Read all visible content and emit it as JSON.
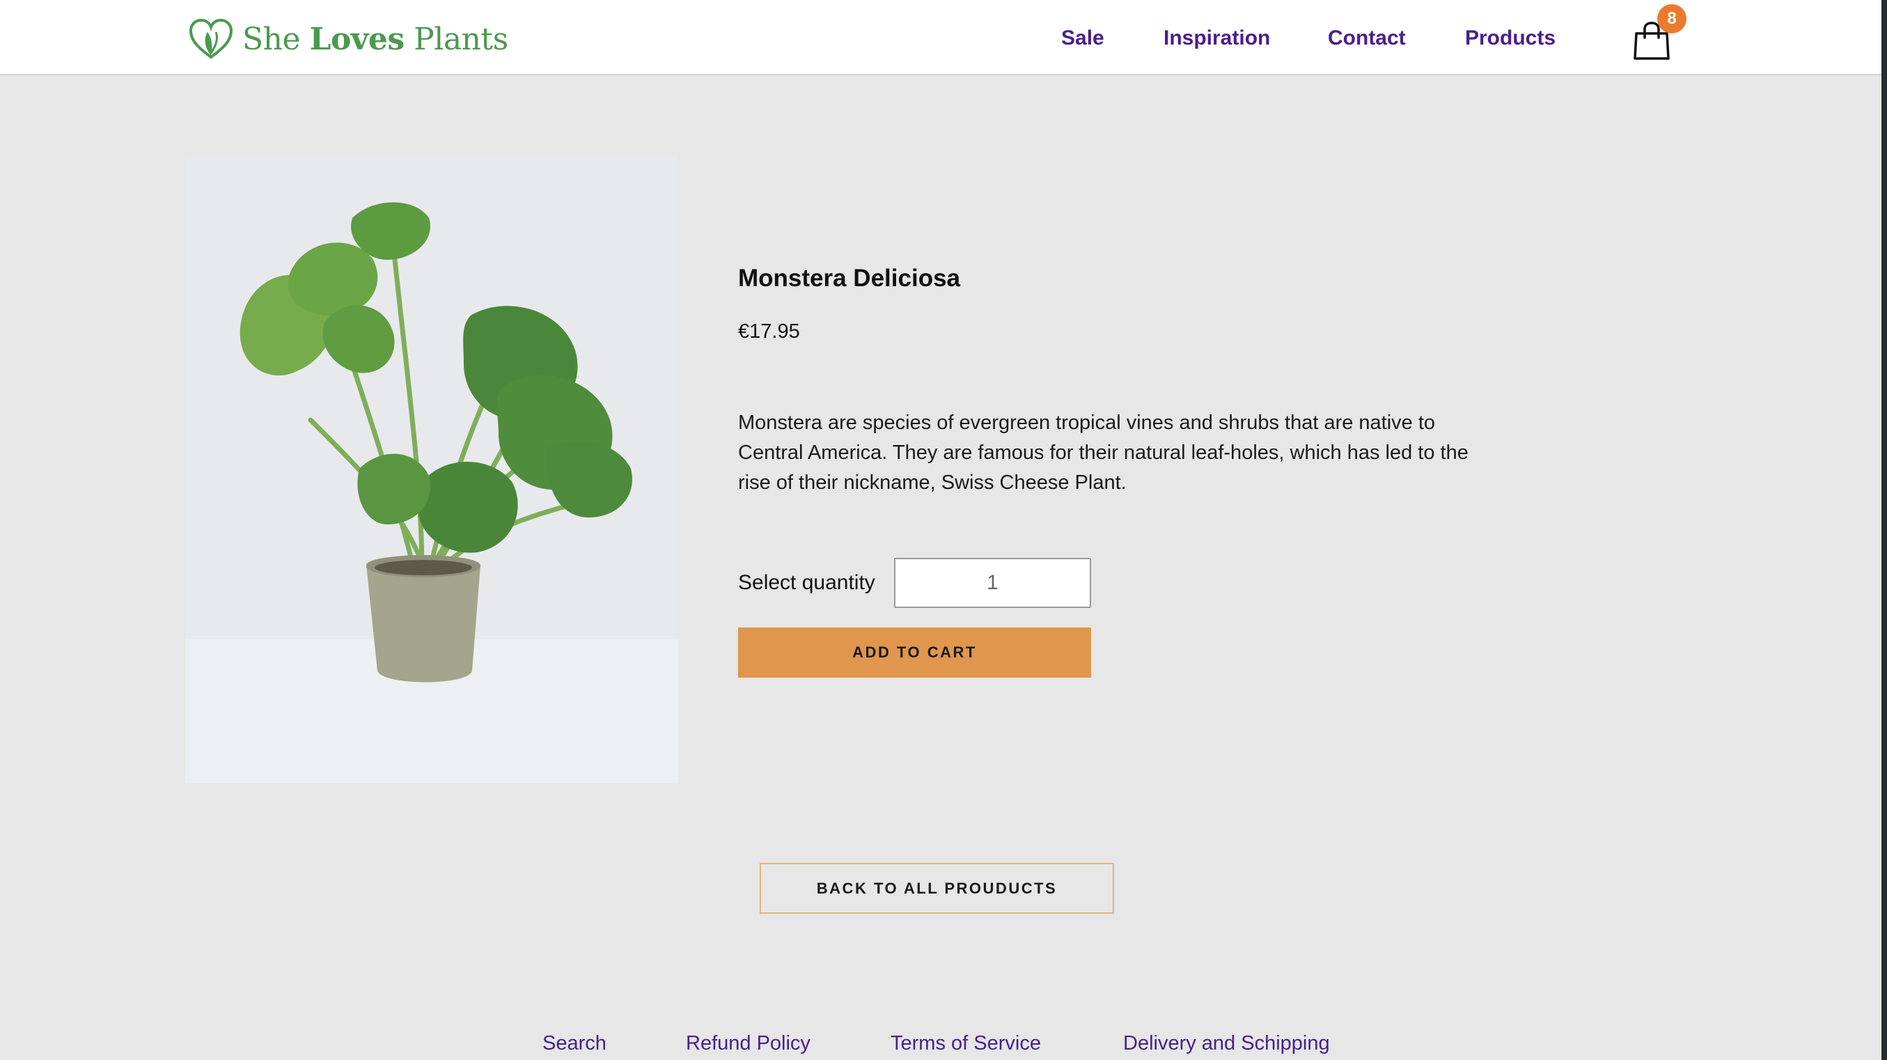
{
  "header": {
    "logo": {
      "word1": "She",
      "word2": "Loves",
      "word3": "Plants",
      "icon": "heart-leaf-icon"
    },
    "nav": [
      {
        "label": "Sale"
      },
      {
        "label": "Inspiration"
      },
      {
        "label": "Contact"
      },
      {
        "label": "Products"
      }
    ],
    "cart": {
      "icon": "shopping-bag-icon",
      "count": "8",
      "badge_color": "#ea7a2e"
    }
  },
  "product": {
    "title": "Monstera Deliciosa",
    "price": "€17.95",
    "description": "Monstera are species of evergreen tropical vines and shrubs that are native to Central America. They are famous for their natural leaf-holes, which has led to the rise of their nickname, Swiss Cheese Plant.",
    "quantity_label": "Select quantity",
    "quantity_value": "1",
    "add_to_cart_label": "ADD TO CART",
    "add_to_cart_color": "#e0964c"
  },
  "back_button_label": "BACK TO ALL PROUDUCTS",
  "footer": {
    "links": [
      {
        "label": "Search"
      },
      {
        "label": "Refund Policy"
      },
      {
        "label": "Terms of Service"
      },
      {
        "label": "Delivery and Schipping"
      }
    ]
  },
  "colors": {
    "brand_green": "#4a9a4f",
    "nav_purple": "#4a1f8c",
    "background": "#e6e7e6"
  }
}
